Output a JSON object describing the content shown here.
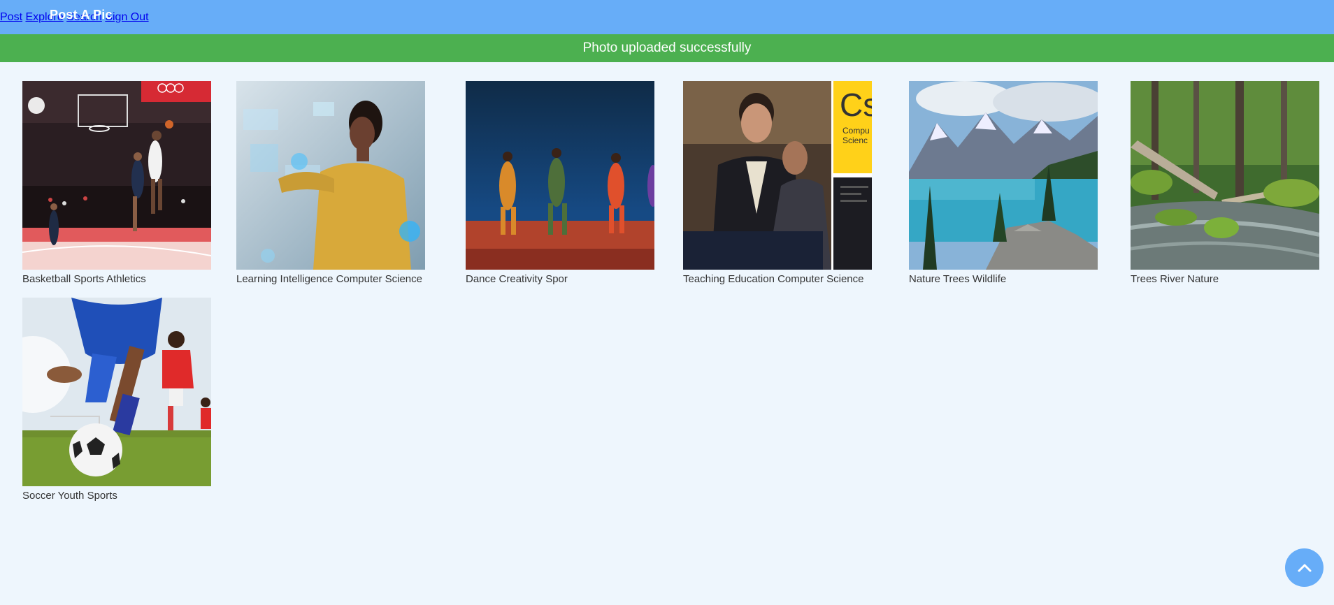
{
  "app": {
    "brand": "Post A Pic"
  },
  "nav": {
    "items": [
      {
        "label": "Post"
      },
      {
        "label": "Explore"
      },
      {
        "label": "Search"
      },
      {
        "label": "Sign Out"
      }
    ]
  },
  "flash": {
    "message": "Photo uploaded successfully",
    "color": "#4cb050"
  },
  "colors": {
    "header": "#67adf8",
    "background": "#eef6fd",
    "accent": "#67adf8"
  },
  "photos": [
    {
      "caption": "Basketball Sports Athletics",
      "image": "basketball game photo"
    },
    {
      "caption": "Learning Intelligence Computer Science",
      "image": "woman with holographic interface photo"
    },
    {
      "caption": "Dance Creativity Spor",
      "image": "dancers on stage photo"
    },
    {
      "caption": "Teaching Education Computer Science",
      "image": "teacher with student photo"
    },
    {
      "caption": "Nature Trees Wildlife",
      "image": "mountain lake photo"
    },
    {
      "caption": "Trees River Nature",
      "image": "forest river photo"
    },
    {
      "caption": "Soccer Youth Sports",
      "image": "youth soccer photo"
    }
  ],
  "scroll_top": {
    "icon": "chevron-up-icon"
  }
}
